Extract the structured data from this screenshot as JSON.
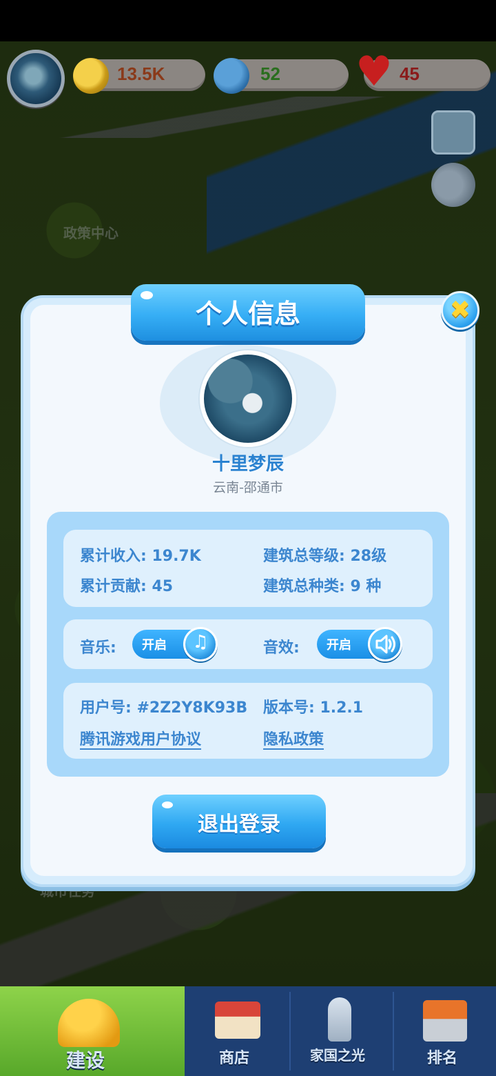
{
  "resources": {
    "coins": "13.5K",
    "stars": "52",
    "hearts": "45"
  },
  "map_labels": {
    "policy_center": "政策中心",
    "city_tasks": "城市任务"
  },
  "dialog": {
    "title": "个人信息",
    "nickname": "十里梦辰",
    "location": "云南-邵通市",
    "stats": {
      "total_income": "累计收入: 19.7K",
      "total_contribution": "累计贡献: 45",
      "building_total_level": "建筑总等级: 28级",
      "building_total_types": "建筑总种类: 9 种"
    },
    "settings": {
      "music_label": "音乐:",
      "music_state": "开启",
      "sound_label": "音效:",
      "sound_state": "开启"
    },
    "account": {
      "user_id": "用户号: #2Z2Y8K93B",
      "version": "版本号: 1.2.1",
      "agreement_link": "腾讯游戏用户协议",
      "privacy_link": "隐私政策"
    },
    "logout_label": "退出登录"
  },
  "bottom_nav": {
    "items": [
      {
        "label": "建设",
        "active": true
      },
      {
        "label": "商店",
        "active": false
      },
      {
        "label": "家国之光",
        "active": false
      },
      {
        "label": "排名",
        "active": false
      }
    ]
  },
  "colors": {
    "accent": "#2a82d0",
    "panel": "#a8d8fa",
    "nav_bg": "#1e3f73",
    "nav_active": "#58a82a"
  }
}
